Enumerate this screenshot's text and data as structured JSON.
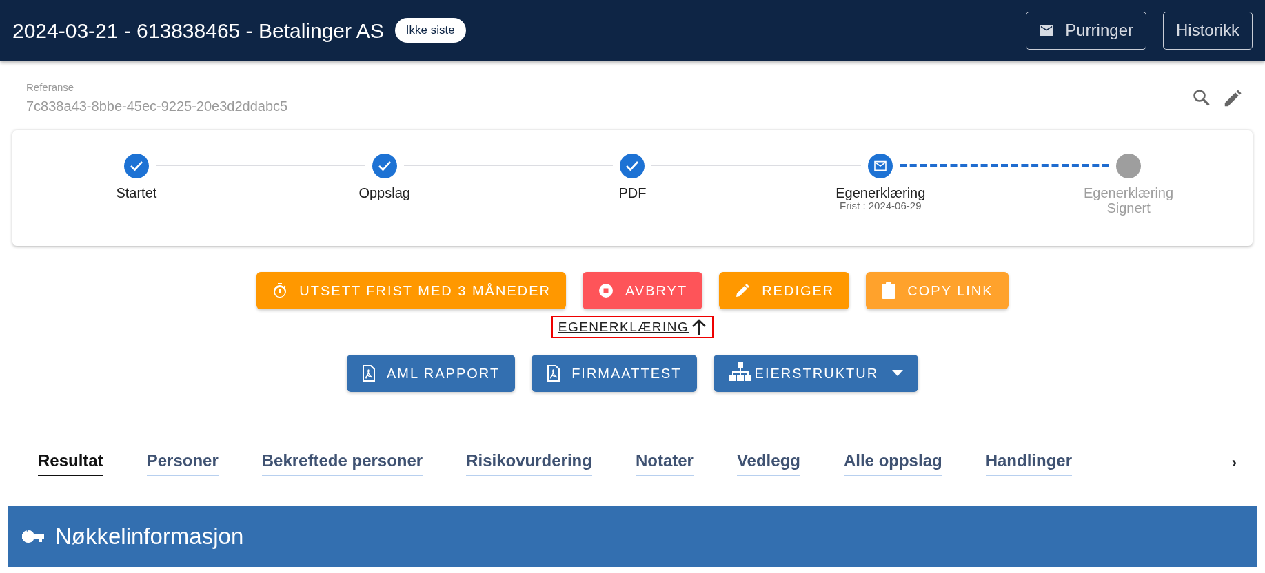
{
  "header": {
    "title": "2024-03-21 - 613838465 - Betalinger AS",
    "badge": "Ikke siste",
    "buttons": [
      {
        "label": "Purringer",
        "kind": "reminders"
      },
      {
        "label": "Historikk",
        "kind": "history"
      }
    ]
  },
  "reference": {
    "label": "Referanse",
    "value": "7c838a43-8bbe-45ec-9225-20e3d2ddabc5"
  },
  "steps": [
    {
      "label": "Startet",
      "completed": true,
      "active": false
    },
    {
      "label": "Oppslag",
      "completed": true,
      "active": false
    },
    {
      "label": "PDF",
      "completed": true,
      "active": false
    },
    {
      "label": "Egenerklæring",
      "sub": "Frist : 2024-06-29",
      "completed": false,
      "active": true
    },
    {
      "label": "Egenerklæring Signert",
      "completed": false,
      "active": false
    }
  ],
  "actions": [
    {
      "label": "UTSETT FRIST MED 3 MÅNEDER",
      "kind": "postpone"
    },
    {
      "label": "AVBRYT",
      "kind": "cancel"
    },
    {
      "label": "REDIGER",
      "kind": "edit"
    },
    {
      "label": "COPY LINK",
      "kind": "copy"
    }
  ],
  "link": {
    "label": "EGENERKLÆRING"
  },
  "reports": [
    {
      "label": "AML RAPPORT",
      "kind": "pdf"
    },
    {
      "label": "FIRMAATTEST",
      "kind": "pdf"
    },
    {
      "label": "EIERSTRUKTUR",
      "kind": "menu"
    }
  ],
  "tabs": [
    {
      "label": "Resultat",
      "selected": true
    },
    {
      "label": "Personer",
      "selected": false
    },
    {
      "label": "Bekreftede personer",
      "selected": false
    },
    {
      "label": "Risikovurdering",
      "selected": false
    },
    {
      "label": "Notater",
      "selected": false
    },
    {
      "label": "Vedlegg",
      "selected": false
    },
    {
      "label": "Alle oppslag",
      "selected": false
    },
    {
      "label": "Handlinger",
      "selected": false
    }
  ],
  "tab_scroll": "›",
  "section": {
    "title": "Nøkkelinformasjon"
  }
}
